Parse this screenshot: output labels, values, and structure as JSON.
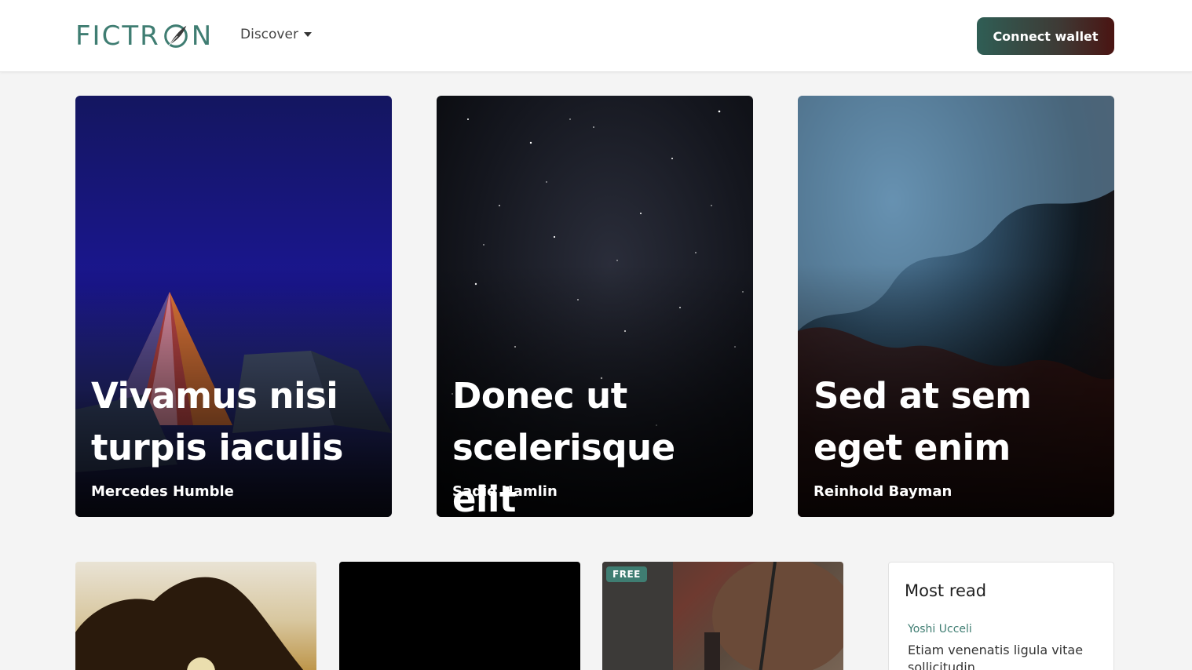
{
  "header": {
    "logo_text_left": "FICTR",
    "logo_text_right": "N",
    "discover_label": "Discover",
    "connect_label": "Connect wallet"
  },
  "featured": [
    {
      "title": "Vivamus nisi turpis iaculis",
      "author": "Mercedes Humble"
    },
    {
      "title": "Donec ut scelerisque elit",
      "author": "Sadie Hamlin"
    },
    {
      "title": "Sed at sem eget enim",
      "author": "Reinhold Bayman"
    }
  ],
  "bottom_row": {
    "badge": "FREE"
  },
  "most_read": {
    "title": "Most read",
    "author": "Yoshi Ucceli",
    "text": "Etiam venenatis ligula vitae sollicitudin"
  },
  "colors": {
    "brand": "#3f7d72",
    "background": "#f4f4f4"
  }
}
